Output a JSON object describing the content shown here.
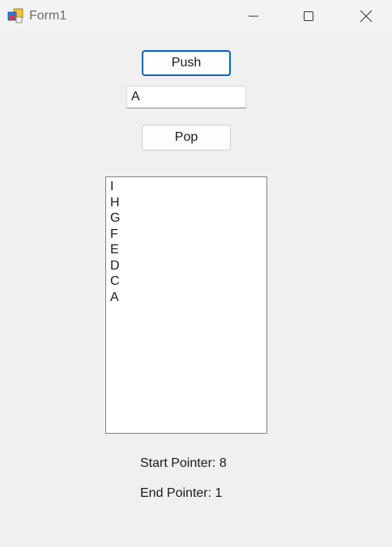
{
  "window": {
    "title": "Form1",
    "controls": {
      "minimize": "minimize-icon",
      "maximize": "maximize-icon",
      "close": "close-icon"
    }
  },
  "form": {
    "push_label": "Push",
    "input_value": "A",
    "pop_label": "Pop",
    "stack_items": [
      "I",
      "H",
      "G",
      "F",
      "E",
      "D",
      "C",
      "A"
    ],
    "start_pointer": "Start Pointer: 8",
    "end_pointer": "End Pointer: 1"
  },
  "colors": {
    "focus_border": "#0067c0",
    "background": "#f0f0f0"
  }
}
